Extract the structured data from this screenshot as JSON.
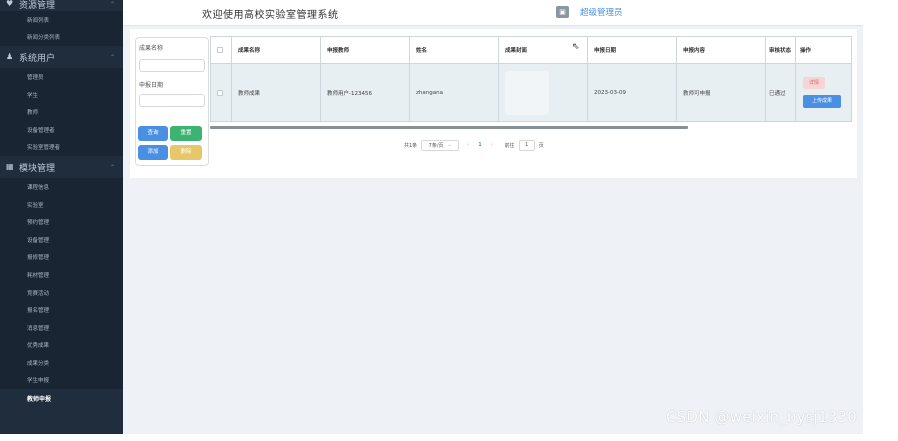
{
  "sidebar": {
    "top_group": {
      "label": "资源管理",
      "icon": "heart-icon"
    },
    "items_top": [
      "新闻列表",
      "新闻分类列表"
    ],
    "group_users": {
      "label": "系统用户",
      "icon": "user-icon"
    },
    "items_users": [
      "管理员",
      "学生",
      "教师",
      "设备管理者",
      "实验室管理者"
    ],
    "group_modules": {
      "label": "模块管理",
      "icon": "grid-icon"
    },
    "items_modules": [
      "课程信息",
      "实验室",
      "预约管理",
      "设备管理",
      "报修管理",
      "耗材管理",
      "竞赛活动",
      "报名管理",
      "消息管理",
      "优秀成果",
      "成果分类",
      "学生申报",
      "教师申报"
    ]
  },
  "header": {
    "welcome": "欢迎使用高校实验室管理系统",
    "role": "超级管理员"
  },
  "search": {
    "field1_label": "成果名称",
    "field2_label": "申报日期",
    "query_label": "查询",
    "reset_label": "重置",
    "add_label": "添加",
    "delete_label": "删除"
  },
  "table": {
    "headers": [
      "成果名称",
      "申报教师",
      "姓名",
      "成果封面",
      "申报日期",
      "申报内容",
      "审核状态",
      "操作"
    ],
    "rows": [
      {
        "name": "教师成果",
        "teacher": "教师用户-123456",
        "real_name": "zhangana",
        "date": "2023-03-09",
        "content": "教师可申报",
        "status": "已通过",
        "detail_label": "详情",
        "upload_label": "上传成果"
      }
    ]
  },
  "pager": {
    "total": "共1条",
    "page_size": "7条/页",
    "prev": "‹",
    "current": "1",
    "next": "›",
    "goto_label": "前往",
    "goto_value": "1",
    "page_suffix": "页"
  },
  "watermark": "CSDN @weixin_bysj1330",
  "colors": {
    "sidebar_bg": "#1f2d3d",
    "accent": "#4a90e2",
    "success": "#3cb371",
    "warning": "#e6c86a",
    "danger_light": "#f5d5d5"
  }
}
